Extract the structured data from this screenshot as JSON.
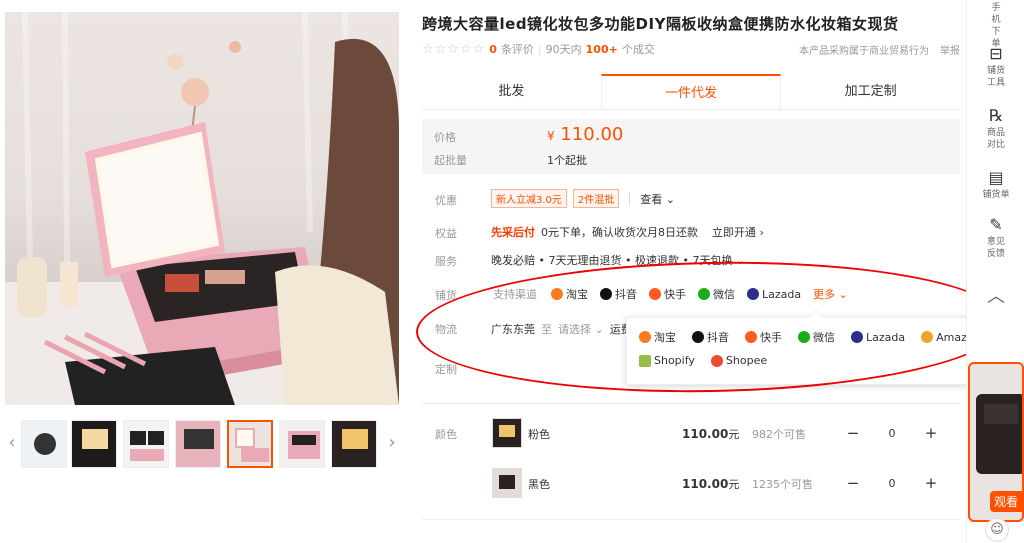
{
  "product": {
    "title": "跨境大容量led镜化妆包多功能DIY隔板收纳盒便携防水化妆箱女现货",
    "stars": "☆☆☆☆☆",
    "reviews_count": "0",
    "reviews_label": "条评价",
    "sold_prefix": "90天内",
    "sold_count": "100+",
    "sold_suffix": "个成交",
    "trade_note": "本产品采购属于商业贸易行为",
    "report": "举报"
  },
  "tabs": [
    "批发",
    "一件代发",
    "加工定制"
  ],
  "price": {
    "label": "价格",
    "currency": "¥",
    "value": "110.00",
    "min_label": "起批量",
    "min_value": "1个起批"
  },
  "discount": {
    "label": "优惠",
    "coupon1": "新人立减3.0元",
    "coupon2": "2件混批",
    "view": "查看 ⌄"
  },
  "rights": {
    "label": "权益",
    "strong": "先采后付",
    "text": "0元下单，确认收货次月8日还款",
    "action": "立即开通 ›"
  },
  "service": {
    "label": "服务",
    "text": "晚发必赔 • 7天无理由退货 • 极速退款 • 7天包换 ⌄"
  },
  "dropship": {
    "label": "铺货",
    "support": "支持渠道",
    "channels": [
      "淘宝",
      "抖音",
      "快手",
      "微信",
      "Lazada"
    ],
    "more": "更多 ⌄"
  },
  "logistics": {
    "label": "物流",
    "from": "广东东莞",
    "to": "至",
    "select": "请选择 ⌄",
    "fee": "运费"
  },
  "custom_label": "定制",
  "popup": {
    "row1": [
      "淘宝",
      "抖音",
      "快手",
      "微信",
      "Lazada",
      "Amazon"
    ],
    "row2": [
      "Shopify",
      "Shopee"
    ]
  },
  "sku": {
    "label": "颜色",
    "items": [
      {
        "name": "粉色",
        "price": "110.00",
        "unit": "元",
        "stock": "982个可售",
        "qty": "0"
      },
      {
        "name": "黑色",
        "price": "110.00",
        "unit": "元",
        "stock": "1235个可售",
        "qty": "0"
      }
    ]
  },
  "sidebar": {
    "items": [
      {
        "icon": "",
        "label": "手机下单"
      },
      {
        "icon": "⊟",
        "label": "铺货工具"
      },
      {
        "icon": "℞",
        "label": "商品对比"
      },
      {
        "icon": "▤",
        "label": "铺货单"
      },
      {
        "icon": "✎",
        "label": "意见反馈"
      }
    ],
    "video_tag": "观看"
  },
  "colors": {
    "accent": "#ff5000",
    "annotation": "#ee0000"
  }
}
